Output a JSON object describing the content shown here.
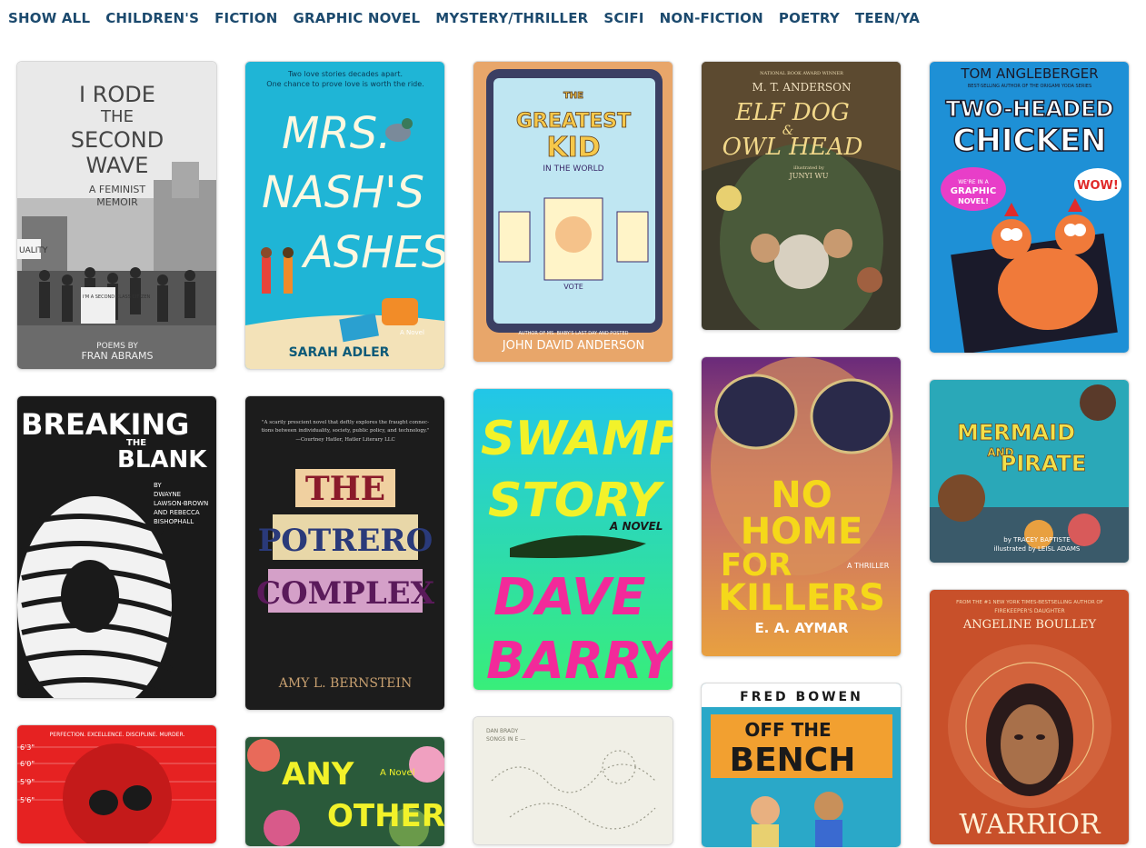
{
  "filters": [
    "SHOW ALL",
    "CHILDREN'S",
    "FICTION",
    "GRAPHIC NOVEL",
    "MYSTERY/THRILLER",
    "SCIFI",
    "NON-FICTION",
    "POETRY",
    "TEEN/YA"
  ],
  "books": {
    "rode": {
      "line1": "I RODE",
      "line2": "THE",
      "line3": "SECOND",
      "line4": "WAVE",
      "subtitle1": "A FEMINIST",
      "subtitle2": "MEMOIR",
      "byline": "POEMS BY",
      "author": "FRAN ABRAMS",
      "sign1": "UALITY",
      "sign2": "I'M A SECOND CLASS CITIZEN"
    },
    "nash": {
      "tagline1": "Two love stories decades apart.",
      "tagline2": "One chance to prove love is worth the ride.",
      "line1": "MRS.",
      "line2": "NASH'S",
      "line3": "ASHES",
      "note": "A Novel",
      "author": "SARAH ADLER"
    },
    "greatest": {
      "t1": "THE",
      "t2": "GREATEST",
      "t3": "KID",
      "t4": "IN THE WORLD",
      "vote": "VOTE",
      "blurb": "AUTHOR OF MS. BIXBY'S LAST DAY AND POSTED",
      "author": "JOHN DAVID ANDERSON"
    },
    "elf": {
      "award": "NATIONAL BOOK AWARD WINNER",
      "author": "M. T. ANDERSON",
      "t1": "ELF DOG",
      "t2": "&",
      "t3": "OWL HEAD",
      "illus1": "illustrated by",
      "illus2": "JUNYI WU"
    },
    "chicken": {
      "author": "TOM ANGLEBERGER",
      "blurb": "BEST-SELLING AUTHOR OF THE ORIGAMI YODA SERIES",
      "t1": "TWO-HEADED",
      "t2": "CHICKEN",
      "bubble1": "WE'RE IN A",
      "bubble2": "GRAPHIC",
      "bubble3": "NOVEL!",
      "wow": "WOW!"
    },
    "blank": {
      "t1": "BREAKING",
      "t2": "THE",
      "t3": "BLANK",
      "by": "BY",
      "a1": "DWAYNE",
      "a2": "LAWSON-BROWN",
      "a3": "AND REBECCA",
      "a4": "BISHOPHALL"
    },
    "potrero": {
      "quote1": "\"A scarily prescient novel that deftly explores the fraught connec-",
      "quote2": "tions between individuality, society, public policy, and technology.\"",
      "quote3": "—Courtney Hatler, Hatler Literary LLC",
      "t1": "THE",
      "t2": "POTRERO",
      "t3": "COMPLEX",
      "author": "AMY L. BERNSTEIN"
    },
    "swamp": {
      "t1": "SWAMP",
      "t2": "STORY",
      "note": "A NOVEL",
      "a1": "DAVE",
      "a2": "BARRY"
    },
    "killers": {
      "t1": "NO",
      "t2": "HOME",
      "t3": "FOR",
      "t4": "KILLERS",
      "note": "A THRILLER",
      "author": "E. A. AYMAR"
    },
    "mermaid": {
      "t1": "MERMAID",
      "t2": "AND",
      "t3": "PIRATE",
      "a1": "by TRACEY BAPTISTE",
      "a2": "illustrated by LEISL ADAMS"
    },
    "perfection": {
      "tag": "PERFECTION. EXCELLENCE. DISCIPLINE. MURDER.",
      "h1": "6'3\"",
      "h2": "6'0\"",
      "h3": "5'9\"",
      "h4": "5'6\""
    },
    "anyother": {
      "t1": "ANY",
      "t2": "OTHER",
      "note": "A Novel"
    },
    "songs": {
      "top": "DAN BRADY",
      "sub": "SONGS IN E —"
    },
    "bench": {
      "author": "FRED BOWEN",
      "t1": "OFF THE",
      "t2": "BENCH"
    },
    "warrior": {
      "blurb1": "FROM THE #1 NEW YORK TIMES-BESTSELLING AUTHOR OF",
      "blurb2": "FIREKEEPER'S DAUGHTER",
      "author": "ANGELINE BOULLEY",
      "title": "WARRIOR"
    }
  },
  "colors": {
    "filter": "#1c4a6e",
    "nash_bg": "#1fb5d6",
    "swamp_bg": "#2ee6a8",
    "killers_bg": "#f2c200",
    "warrior_bg": "#c8502a",
    "chicken_bg": "#1e90d6"
  }
}
